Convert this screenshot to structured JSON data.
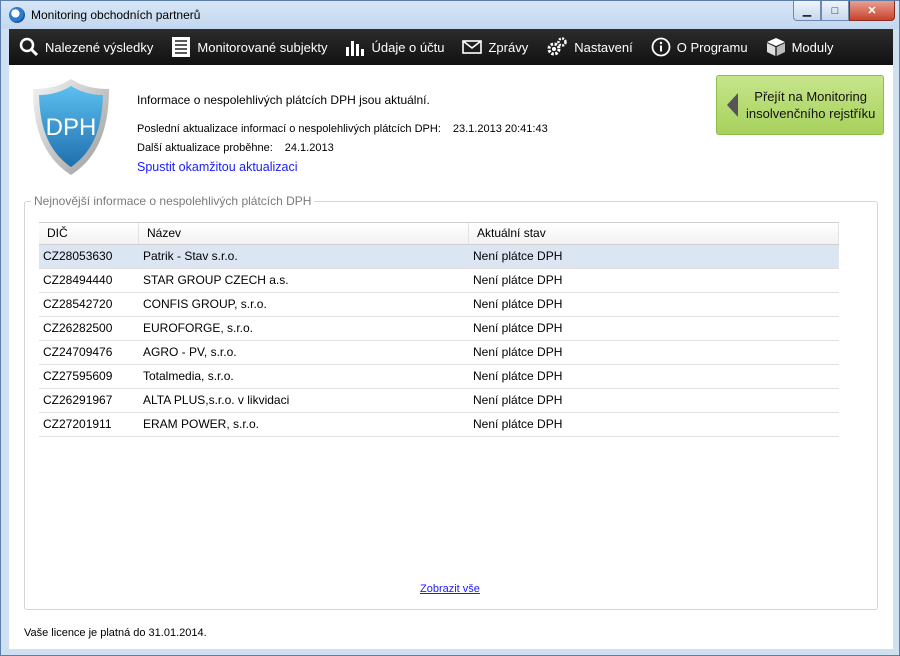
{
  "window": {
    "title": "Monitoring obchodních partnerů",
    "controls": {
      "minimize": "▁",
      "maximize": "□",
      "close": "✕"
    }
  },
  "menu": [
    {
      "label": "Nalezené výsledky",
      "icon": "search-icon"
    },
    {
      "label": "Monitorované subjekty",
      "icon": "list-icon"
    },
    {
      "label": "Údaje o účtu",
      "icon": "bar-chart-icon"
    },
    {
      "label": "Zprávy",
      "icon": "envelope-icon"
    },
    {
      "label": "Nastavení",
      "icon": "gears-icon"
    },
    {
      "label": "O Programu",
      "icon": "info-icon"
    },
    {
      "label": "Moduly",
      "icon": "cube-icon"
    }
  ],
  "info": {
    "shield_text": "DPH",
    "title": "Informace o nespolehlivých plátcích DPH jsou aktuální.",
    "last_update_label": "Poslední aktualizace informací o nespolehlivých plátcích DPH:",
    "last_update_value": "23.1.2013 20:41:43",
    "next_update_label": "Další aktualizace proběhne:",
    "next_update_value": "24.1.2013",
    "update_now_link": "Spustit okamžitou aktualizaci"
  },
  "goto_button": {
    "line1": "Přejít na Monitoring",
    "line2": "insolvenčního rejstříku"
  },
  "group_title": "Nejnovější informace o nespolehlivých plátcích DPH",
  "table": {
    "columns": [
      "DIČ",
      "Název",
      "Aktuální stav"
    ],
    "rows": [
      [
        "CZ28053630",
        "Patrik - Stav s.r.o.",
        "Není plátce DPH"
      ],
      [
        "CZ28494440",
        "STAR GROUP CZECH a.s.",
        "Není plátce DPH"
      ],
      [
        "CZ28542720",
        "CONFIS GROUP, s.r.o.",
        "Není plátce DPH"
      ],
      [
        "CZ26282500",
        "EUROFORGE, s.r.o.",
        "Není plátce DPH"
      ],
      [
        "CZ24709476",
        "AGRO - PV, s.r.o.",
        "Není plátce DPH"
      ],
      [
        "CZ27595609",
        "Totalmedia, s.r.o.",
        "Není plátce DPH"
      ],
      [
        "CZ26291967",
        "ALTA PLUS,s.r.o. v likvidaci",
        "Není plátce DPH"
      ],
      [
        "CZ27201911",
        "ERAM POWER, s.r.o.",
        "Není plátce DPH"
      ]
    ]
  },
  "show_all_link": "Zobrazit vše",
  "license_text": "Vaše licence je platná do 31.01.2014.",
  "colors": {
    "menubar": "#1a1a1a",
    "accent_green": "#a7d15d",
    "link": "#1a1aff",
    "selected_row": "#dbe6f2",
    "shield_blue": "#2f8fcf"
  }
}
